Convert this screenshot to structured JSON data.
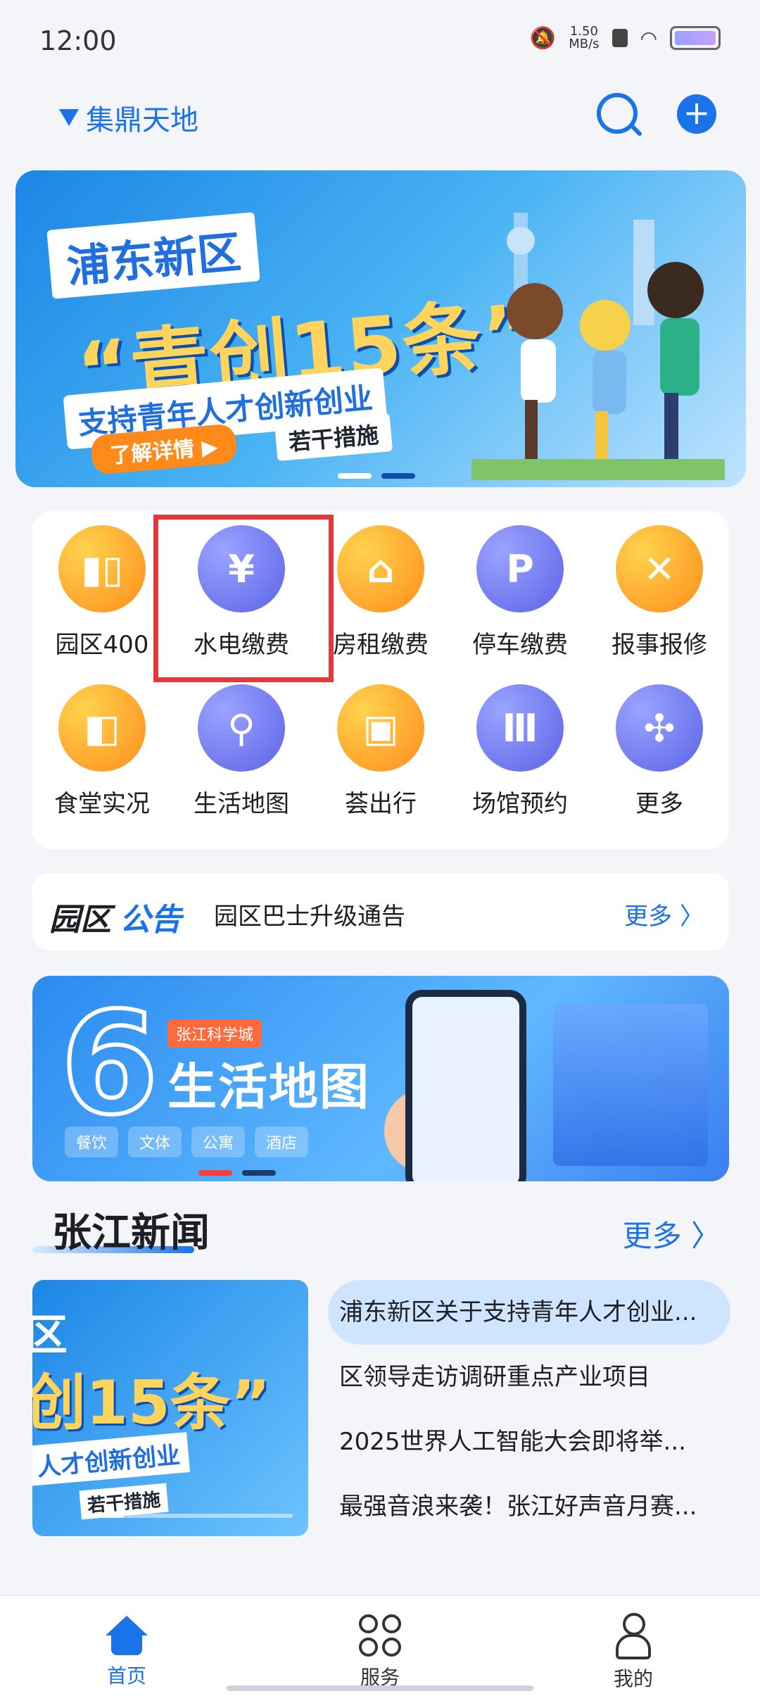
{
  "status_bar": {
    "time": "12:00",
    "net_speed": "1.50",
    "net_unit": "MB/s"
  },
  "header": {
    "location": "集鼎天地"
  },
  "banner": {
    "line1": "浦东新区",
    "line2": "“青创15条”",
    "line3": "支持青年人才创新创业",
    "cta": "了解详情 ▶",
    "tag": "若干措施"
  },
  "services": [
    {
      "label": "园区400",
      "icon": "phone-building-icon",
      "color": "orange"
    },
    {
      "label": "水电缴费",
      "icon": "yen-coin-icon",
      "color": "purple"
    },
    {
      "label": "房租缴费",
      "icon": "house-yen-icon",
      "color": "orange"
    },
    {
      "label": "停车缴费",
      "icon": "parking-icon",
      "color": "purple"
    },
    {
      "label": "报事报修",
      "icon": "wrench-icon",
      "color": "orange"
    },
    {
      "label": "食堂实况",
      "icon": "camera-icon",
      "color": "orange"
    },
    {
      "label": "生活地图",
      "icon": "map-pin-icon",
      "color": "purple"
    },
    {
      "label": "荟出行",
      "icon": "bus-icon",
      "color": "orange"
    },
    {
      "label": "场馆预约",
      "icon": "venue-icon",
      "color": "purple"
    },
    {
      "label": "更多",
      "icon": "clover-icon",
      "color": "purple"
    }
  ],
  "notice": {
    "tag_a": "园区",
    "tag_b": "公告",
    "text": "园区巴士升级通告",
    "more": "更多 〉"
  },
  "map_banner": {
    "number": "6",
    "badge": "张江科学城",
    "title": "生活地图",
    "chips": [
      "餐饮",
      "文体",
      "公寓",
      "酒店"
    ]
  },
  "news": {
    "title": "张江新闻",
    "more": "更多 〉",
    "thumb": {
      "l1": "区",
      "l2": "创15条”",
      "l3": "人才创新创业",
      "l4": "若干措施"
    },
    "items": [
      "浦东新区关于支持青年人才创业...",
      "区领导走访调研重点产业项目",
      "2025世界人工智能大会即将举...",
      "最强音浪来袭！张江好声音月赛..."
    ]
  },
  "tabs": [
    {
      "label": "首页",
      "icon": "home-icon"
    },
    {
      "label": "服务",
      "icon": "services-grid-icon"
    },
    {
      "label": "我的",
      "icon": "person-icon"
    }
  ],
  "colors": {
    "accent": "#1a73e8",
    "highlight": "#e03a3a",
    "orange": "#ff8d1c",
    "purple": "#5b63e6"
  }
}
